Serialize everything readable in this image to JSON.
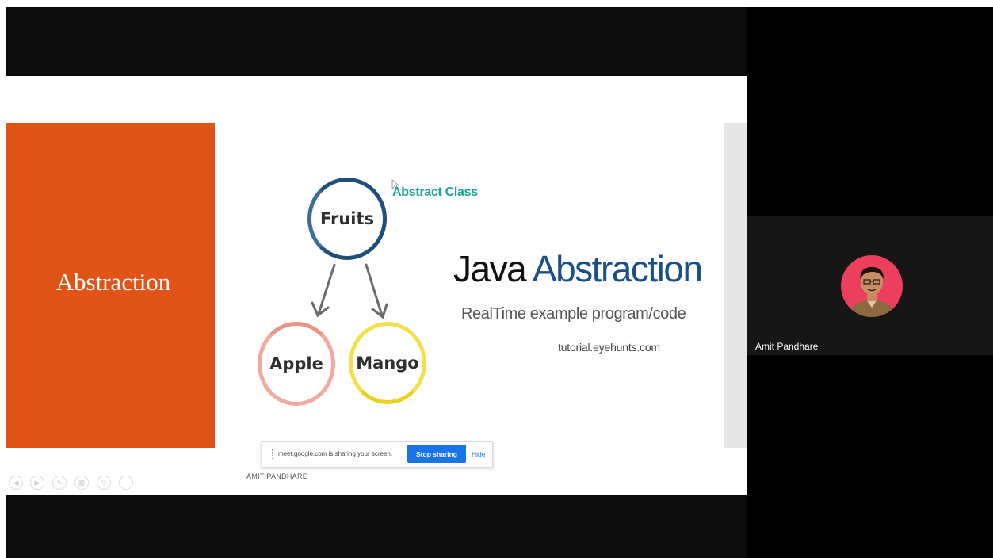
{
  "slide": {
    "orange_title": "Abstraction",
    "diagram": {
      "parent": "Fruits",
      "children": [
        "Apple",
        "Mango"
      ],
      "annotation": "Abstract Class"
    },
    "title_word1": "Java",
    "title_word2": "Abstraction",
    "subtitle": "RealTime example program/code",
    "site": "tutorial.eyehunts.com",
    "footer_name": "AMIT PANDHARE"
  },
  "share_bar": {
    "message": "meet.google.com is sharing your screen.",
    "stop_label": "Stop sharing",
    "hide_label": "Hide"
  },
  "slide_controls": [
    "previous-icon",
    "next-icon",
    "pen-icon",
    "slides-icon",
    "zoom-icon",
    "more-icon"
  ],
  "participant": {
    "name": "Amit Pandhare"
  },
  "colors": {
    "orange": "#e05418",
    "title_blue": "#1c4f84",
    "annotation_teal": "#1aa193",
    "stop_button": "#1a73e8",
    "avatar_bg": "#ec3f5e"
  }
}
